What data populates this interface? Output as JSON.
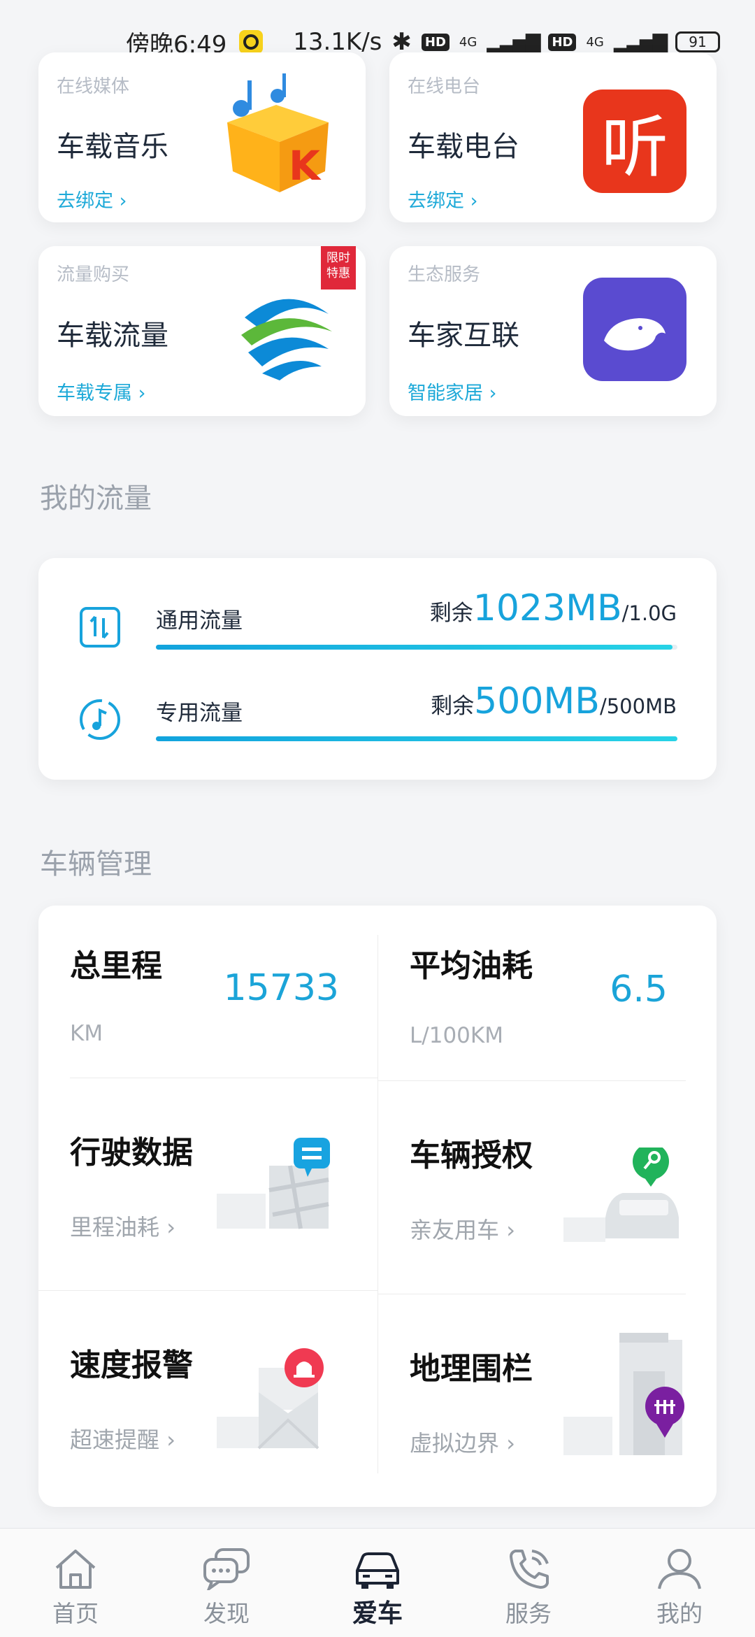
{
  "status_bar": {
    "time": "傍晚6:49",
    "net_speed": "13.1K/s",
    "hd1": "HD",
    "net1": "4G",
    "hd2": "HD",
    "net2": "4G",
    "battery": "91"
  },
  "services": [
    {
      "subtitle": "在线媒体",
      "title": "车载音乐",
      "link": "去绑定",
      "icon": "kugou-music-logo"
    },
    {
      "subtitle": "在线电台",
      "title": "车载电台",
      "link": "去绑定",
      "icon": "ting-radio-logo",
      "logo_text": "听"
    },
    {
      "subtitle": "流量购买",
      "title": "车载流量",
      "link": "车载专属",
      "icon": "china-mobile-logo",
      "badge_line1": "限时",
      "badge_line2": "特惠"
    },
    {
      "subtitle": "生态服务",
      "title": "车家互联",
      "link": "智能家居",
      "icon": "whale-app-logo"
    }
  ],
  "my_flow": {
    "section_title": "我的流量",
    "items": [
      {
        "label": "通用流量",
        "remaining_prefix": "剩余",
        "remaining": "1023MB",
        "total": "/1.0G",
        "fraction": 0.99,
        "icon": "data-transfer-icon"
      },
      {
        "label": "专用流量",
        "remaining_prefix": "剩余",
        "remaining": "500MB",
        "total": "/500MB",
        "fraction": 1.0,
        "icon": "music-note-icon"
      }
    ]
  },
  "vehicle": {
    "section_title": "车辆管理",
    "total_mileage": {
      "title": "总里程",
      "value": "15733",
      "unit": "KM"
    },
    "avg_fuel": {
      "title": "平均油耗",
      "value": "6.5",
      "unit": "L/100KM"
    },
    "tiles": [
      {
        "title": "行驶数据",
        "link": "里程油耗",
        "icon": "map-chat-icon"
      },
      {
        "title": "车辆授权",
        "link": "亲友用车",
        "icon": "car-key-icon"
      },
      {
        "title": "速度报警",
        "link": "超速提醒",
        "icon": "alarm-envelope-icon"
      },
      {
        "title": "地理围栏",
        "link": "虚拟边界",
        "icon": "fence-pin-icon"
      }
    ]
  },
  "nav": [
    {
      "label": "首页",
      "icon": "home-icon",
      "active": false
    },
    {
      "label": "发现",
      "icon": "chat-bubbles-icon",
      "active": false
    },
    {
      "label": "爱车",
      "icon": "car-icon",
      "active": true
    },
    {
      "label": "服务",
      "icon": "phone-icon",
      "active": false
    },
    {
      "label": "我的",
      "icon": "user-icon",
      "active": false
    }
  ],
  "colors": {
    "accent": "#17a3dc",
    "badge": "#e0283a",
    "ting": "#e8361c",
    "whale": "#5a4bd0"
  }
}
